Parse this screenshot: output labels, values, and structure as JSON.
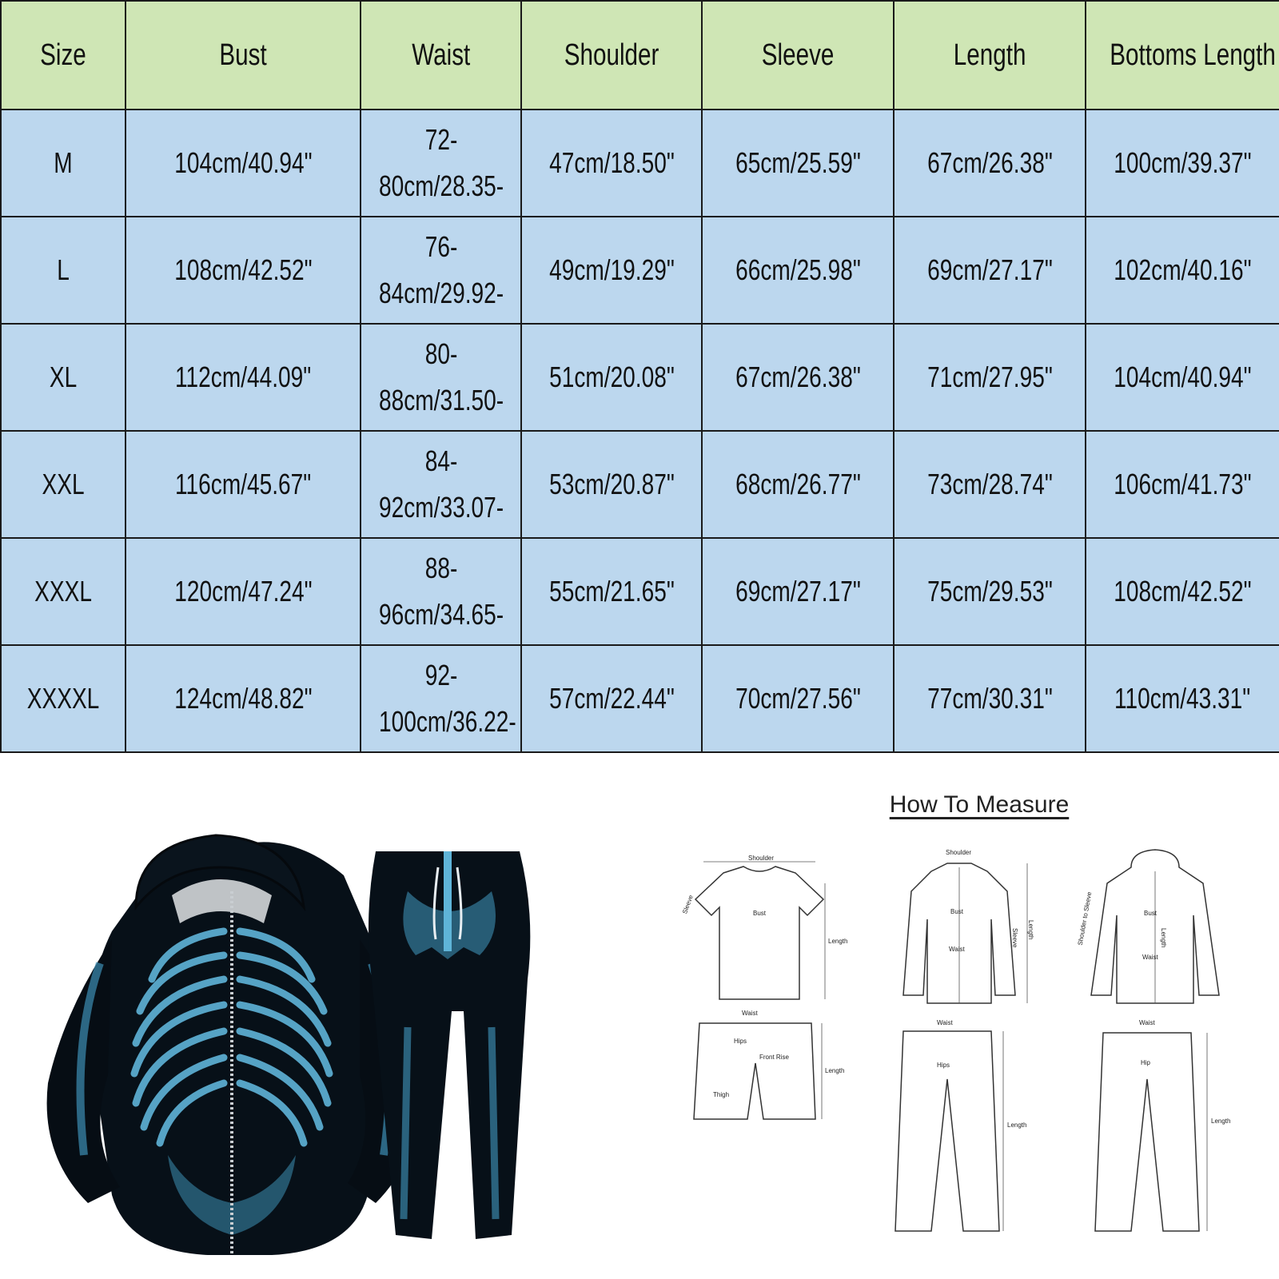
{
  "table": {
    "headers": [
      "Size",
      "Bust",
      "Waist",
      "Shoulder",
      "Sleeve",
      "Length",
      "Bottoms Length"
    ],
    "rows": [
      [
        "M",
        "104cm/40.94\"",
        "72-80cm/28.35-",
        "47cm/18.50\"",
        "65cm/25.59\"",
        "67cm/26.38\"",
        "100cm/39.37\""
      ],
      [
        "L",
        "108cm/42.52\"",
        "76-84cm/29.92-",
        "49cm/19.29\"",
        "66cm/25.98\"",
        "69cm/27.17\"",
        "102cm/40.16\""
      ],
      [
        "XL",
        "112cm/44.09\"",
        "80-88cm/31.50-",
        "51cm/20.08\"",
        "67cm/26.38\"",
        "71cm/27.95\"",
        "104cm/40.94\""
      ],
      [
        "XXL",
        "116cm/45.67\"",
        "84-92cm/33.07-",
        "53cm/20.87\"",
        "68cm/26.77\"",
        "73cm/28.74\"",
        "106cm/41.73\""
      ],
      [
        "XXXL",
        "120cm/47.24\"",
        "88-96cm/34.65-",
        "55cm/21.65\"",
        "69cm/27.17\"",
        "75cm/29.53\"",
        "108cm/42.52\""
      ],
      [
        "XXXXL",
        "124cm/48.82\"",
        "92-100cm/36.22-",
        "57cm/22.44\"",
        "70cm/27.56\"",
        "77cm/30.31\"",
        "110cm/43.31\""
      ]
    ]
  },
  "colors": {
    "header_bg": "#cfe6b5",
    "cell_bg": "#bcd7ee",
    "border": "#1a1a1a",
    "bone": "#5fb4d8",
    "garment": "#071018"
  },
  "measure": {
    "title": "How To Measure",
    "labels": {
      "shoulder": "Shoulder",
      "sleeve": "Sleeve",
      "bust": "Bust",
      "length": "Length",
      "waist": "Waist",
      "hips": "Hips",
      "hip": "Hip",
      "front_rise": "Front Rise",
      "thigh": "Thigh",
      "shoulder_to_sleeve": "Shoulder to Sleeve"
    }
  },
  "product_image": {
    "icon": "skeleton-print-tracksuit-image"
  }
}
